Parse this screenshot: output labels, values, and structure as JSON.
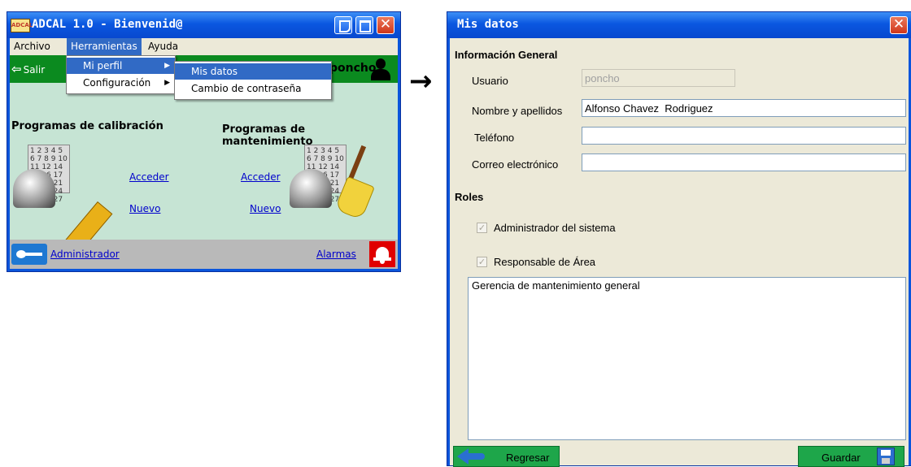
{
  "left_window": {
    "icon_text": "ADCAL",
    "title": "ADCAL 1.0 - Bienvenid@",
    "menubar": [
      "Archivo",
      "Herramientas",
      "Ayuda"
    ],
    "toolbar": {
      "exit_label": "Salir",
      "username": "poncho"
    },
    "calibration": {
      "heading": "Programas de calibración",
      "access_link": "Acceder",
      "new_link": "Nuevo"
    },
    "maintenance": {
      "heading": "Programas de mantenimiento",
      "access_link": "Acceder",
      "new_link": "Nuevo"
    },
    "footer": {
      "admin_link": "Administrador",
      "alarms_link": "Alarmas"
    },
    "menu_herramientas": [
      "Mi perfil",
      "Configuración"
    ],
    "submenu_mi_perfil": [
      "Mis datos",
      "Cambio de contraseña"
    ],
    "calendar_text": "1 2 3 4 5 6 7 8 9 10 11 12 14 15 16 17 18 19 21 22 23 24 25 26 27"
  },
  "arrow": "→",
  "right_window": {
    "title": "Mis datos",
    "general_section": "Información General",
    "fields": {
      "usuario": {
        "label": "Usuario",
        "value": "poncho"
      },
      "nombre": {
        "label": "Nombre y apellidos",
        "value": "Alfonso Chavez  Rodriguez"
      },
      "telefono": {
        "label": "Teléfono",
        "value": ""
      },
      "correo": {
        "label": "Correo electrónico",
        "value": ""
      }
    },
    "roles_section": "Roles",
    "roles": [
      {
        "label": "Administrador del sistema",
        "checked": true
      },
      {
        "label": "Responsable de Área",
        "checked": true
      }
    ],
    "area_text": "Gerencia de mantenimiento general",
    "buttons": {
      "back": "Regresar",
      "save": "Guardar"
    }
  },
  "colors": {
    "titlebar": "#0a57e0",
    "green_toolbar": "#0b8a1f",
    "client_green": "#c6e4d4",
    "menu_highlight": "#316ac5",
    "form_bg": "#ece9d8",
    "button_green": "#1ea64a",
    "alarm_red": "#e00000"
  }
}
